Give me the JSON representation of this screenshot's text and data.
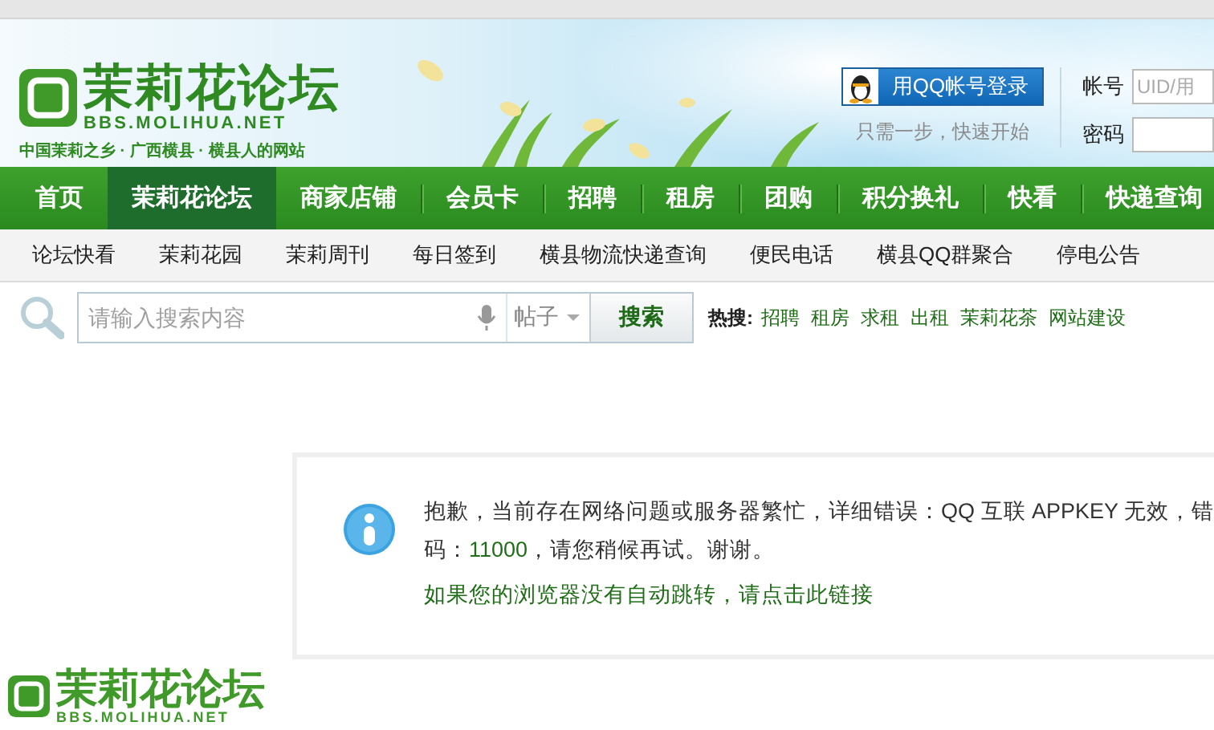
{
  "header": {
    "logo": {
      "title": "茉莉花论坛",
      "domain": "BBS.MOLIHUA.NET",
      "tagline": "中国茉莉之乡 · 广西横县 · 横县人的网站"
    },
    "qq_login": {
      "label": "用QQ帐号登录",
      "hint": "只需一步，快速开始"
    },
    "login_fields": [
      {
        "label": "帐号",
        "placeholder": "UID/用"
      },
      {
        "label": "密码"
      }
    ]
  },
  "main_nav": [
    {
      "label": "首页",
      "selected": false
    },
    {
      "label": "茉莉花论坛",
      "selected": true
    },
    {
      "label": "商家店铺",
      "selected": false
    },
    {
      "label": "会员卡",
      "selected": false
    },
    {
      "label": "招聘",
      "selected": false
    },
    {
      "label": "租房",
      "selected": false
    },
    {
      "label": "团购",
      "selected": false
    },
    {
      "label": "积分换礼",
      "selected": false
    },
    {
      "label": "快看",
      "selected": false
    },
    {
      "label": "快递查询",
      "selected": false
    }
  ],
  "sub_nav": [
    "论坛快看",
    "茉莉花园",
    "茉莉周刊",
    "每日签到",
    "横县物流快递查询",
    "便民电话",
    "横县QQ群聚合",
    "停电公告"
  ],
  "search": {
    "placeholder": "请输入搜索内容",
    "scope": "帖子",
    "button": "搜索",
    "hot_label": "热搜:",
    "hot_links": [
      "招聘",
      "租房",
      "求租",
      "出租",
      "茉莉花茶",
      "网站建设"
    ]
  },
  "message": {
    "text_line_1": "抱歉，当前存在网络问题或服务器繁忙，详细错误：QQ 互联 APPKEY 无效，错",
    "text_line_2_start": "码：",
    "error_code": "11000",
    "text_line_2_end": "，请您稍候再试。谢谢。",
    "link": "如果您的浏览器没有自动跳转，请点击此链接"
  },
  "footer": {
    "logo": {
      "title": "茉莉花论坛",
      "domain": "BBS.MOLIHUA.NET"
    }
  }
}
